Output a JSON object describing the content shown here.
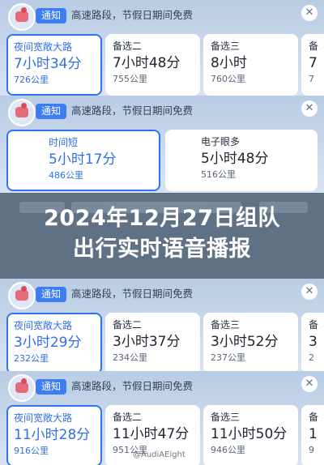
{
  "panels": [
    {
      "badge": "通知",
      "notice": "高速路段，节假日期间免费",
      "routes": [
        {
          "label": "夜间宽敞大路",
          "time": "7小时34分",
          "distance": "726公里",
          "selected": true
        },
        {
          "label": "备选二",
          "time": "7小时48分",
          "distance": "755公里",
          "selected": false
        },
        {
          "label": "备选三",
          "time": "8小时",
          "distance": "760公里",
          "selected": false
        },
        {
          "label": "备",
          "time": "7",
          "distance": "7",
          "selected": false
        }
      ]
    },
    {
      "badge": "通知",
      "notice": "高速路段，节假日期间免费",
      "routes": [
        {
          "label": "时间短",
          "time": "5小时17分",
          "distance": "486公里",
          "selected": true
        },
        {
          "label": "电子眼多",
          "time": "5小时48分",
          "distance": "516公里",
          "selected": false
        }
      ]
    },
    {
      "badge": "通知",
      "notice": "高速路段，节假日期间免费",
      "routes": [
        {
          "label": "夜间宽敞大路",
          "time": "3小时29分",
          "distance": "232公里",
          "selected": true
        },
        {
          "label": "备选二",
          "time": "3小时37分",
          "distance": "234公里",
          "selected": false
        },
        {
          "label": "备选三",
          "time": "3小时52分",
          "distance": "237公里",
          "selected": false
        },
        {
          "label": "备",
          "time": "3",
          "distance": "2",
          "selected": false
        }
      ]
    },
    {
      "badge": "通知",
      "notice": "高速路段，节假日期间免费",
      "routes": [
        {
          "label": "夜间宽敞大路",
          "time": "11小时28分",
          "distance": "916公里",
          "selected": true
        },
        {
          "label": "备选二",
          "time": "11小时47分",
          "distance": "951公里",
          "selected": false
        },
        {
          "label": "备选三",
          "time": "11小时50分",
          "distance": "946公里",
          "selected": false
        },
        {
          "label": "备",
          "time": "1",
          "distance": "9",
          "selected": false
        }
      ]
    }
  ],
  "close_icon": "close-icon",
  "overlay": {
    "title_line1": "2024年12月27日组队",
    "title_line2": "出行实时语音播报"
  },
  "watermark": "@AudiAEight",
  "colors": {
    "accent": "#2f74ef",
    "badge": "#3d7cf2",
    "background": "#b9cce4"
  }
}
